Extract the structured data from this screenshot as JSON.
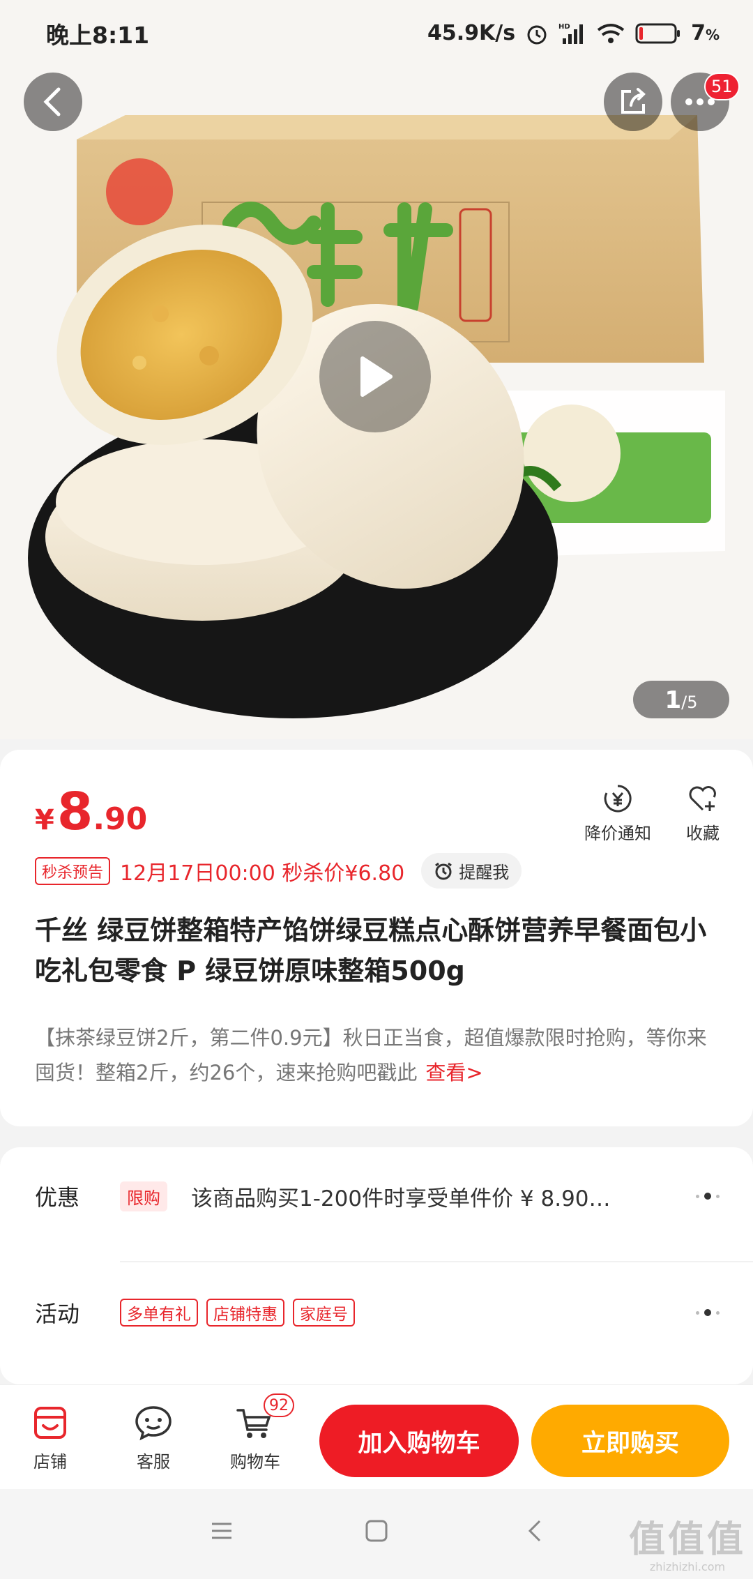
{
  "status_bar": {
    "time": "晚上8:11",
    "net_speed": "45.9K/s",
    "signal": "HD",
    "battery": "7",
    "battery_unit": "%"
  },
  "header": {
    "more_badge": "51"
  },
  "gallery": {
    "current": "1",
    "separator": "/",
    "total": "5"
  },
  "product": {
    "price": {
      "currency": "¥",
      "integer": "8",
      "decimal": ".90"
    },
    "actions": {
      "price_alert": "降价通知",
      "favorite": "收藏"
    },
    "seckill": {
      "tag": "秒杀预告",
      "text": "12月17日00:00 秒杀价¥6.80",
      "remind": "提醒我"
    },
    "title": "千丝 绿豆饼整箱特产馅饼绿豆糕点心酥饼营养早餐面包小吃礼包零食 P 绿豆饼原味整箱500g",
    "description": "【抹茶绿豆饼2斤，第二件0.9元】秋日正当食，超值爆款限时抢购，等你来囤货！整箱2斤，约26个，速来抢购吧戳此",
    "see_more": "查看>"
  },
  "promotions": {
    "discount": {
      "label": "优惠",
      "tag": "限购",
      "text": "该商品购买1-200件时享受单件价 ¥ 8.90…"
    },
    "activity": {
      "label": "活动",
      "tags": [
        "多单有礼",
        "店铺特惠",
        "家庭号"
      ]
    }
  },
  "bottom_bar": {
    "shop": "店铺",
    "service": "客服",
    "cart": "购物车",
    "cart_count": "92",
    "add_to_cart": "加入购物车",
    "buy_now": "立即购买"
  },
  "watermark": {
    "big": "值值值",
    "small": "zhizhizhi.com"
  },
  "colors": {
    "accent_red": "#e8262c",
    "buy_orange": "#ffaa00",
    "cart_red": "#ee1c25"
  }
}
